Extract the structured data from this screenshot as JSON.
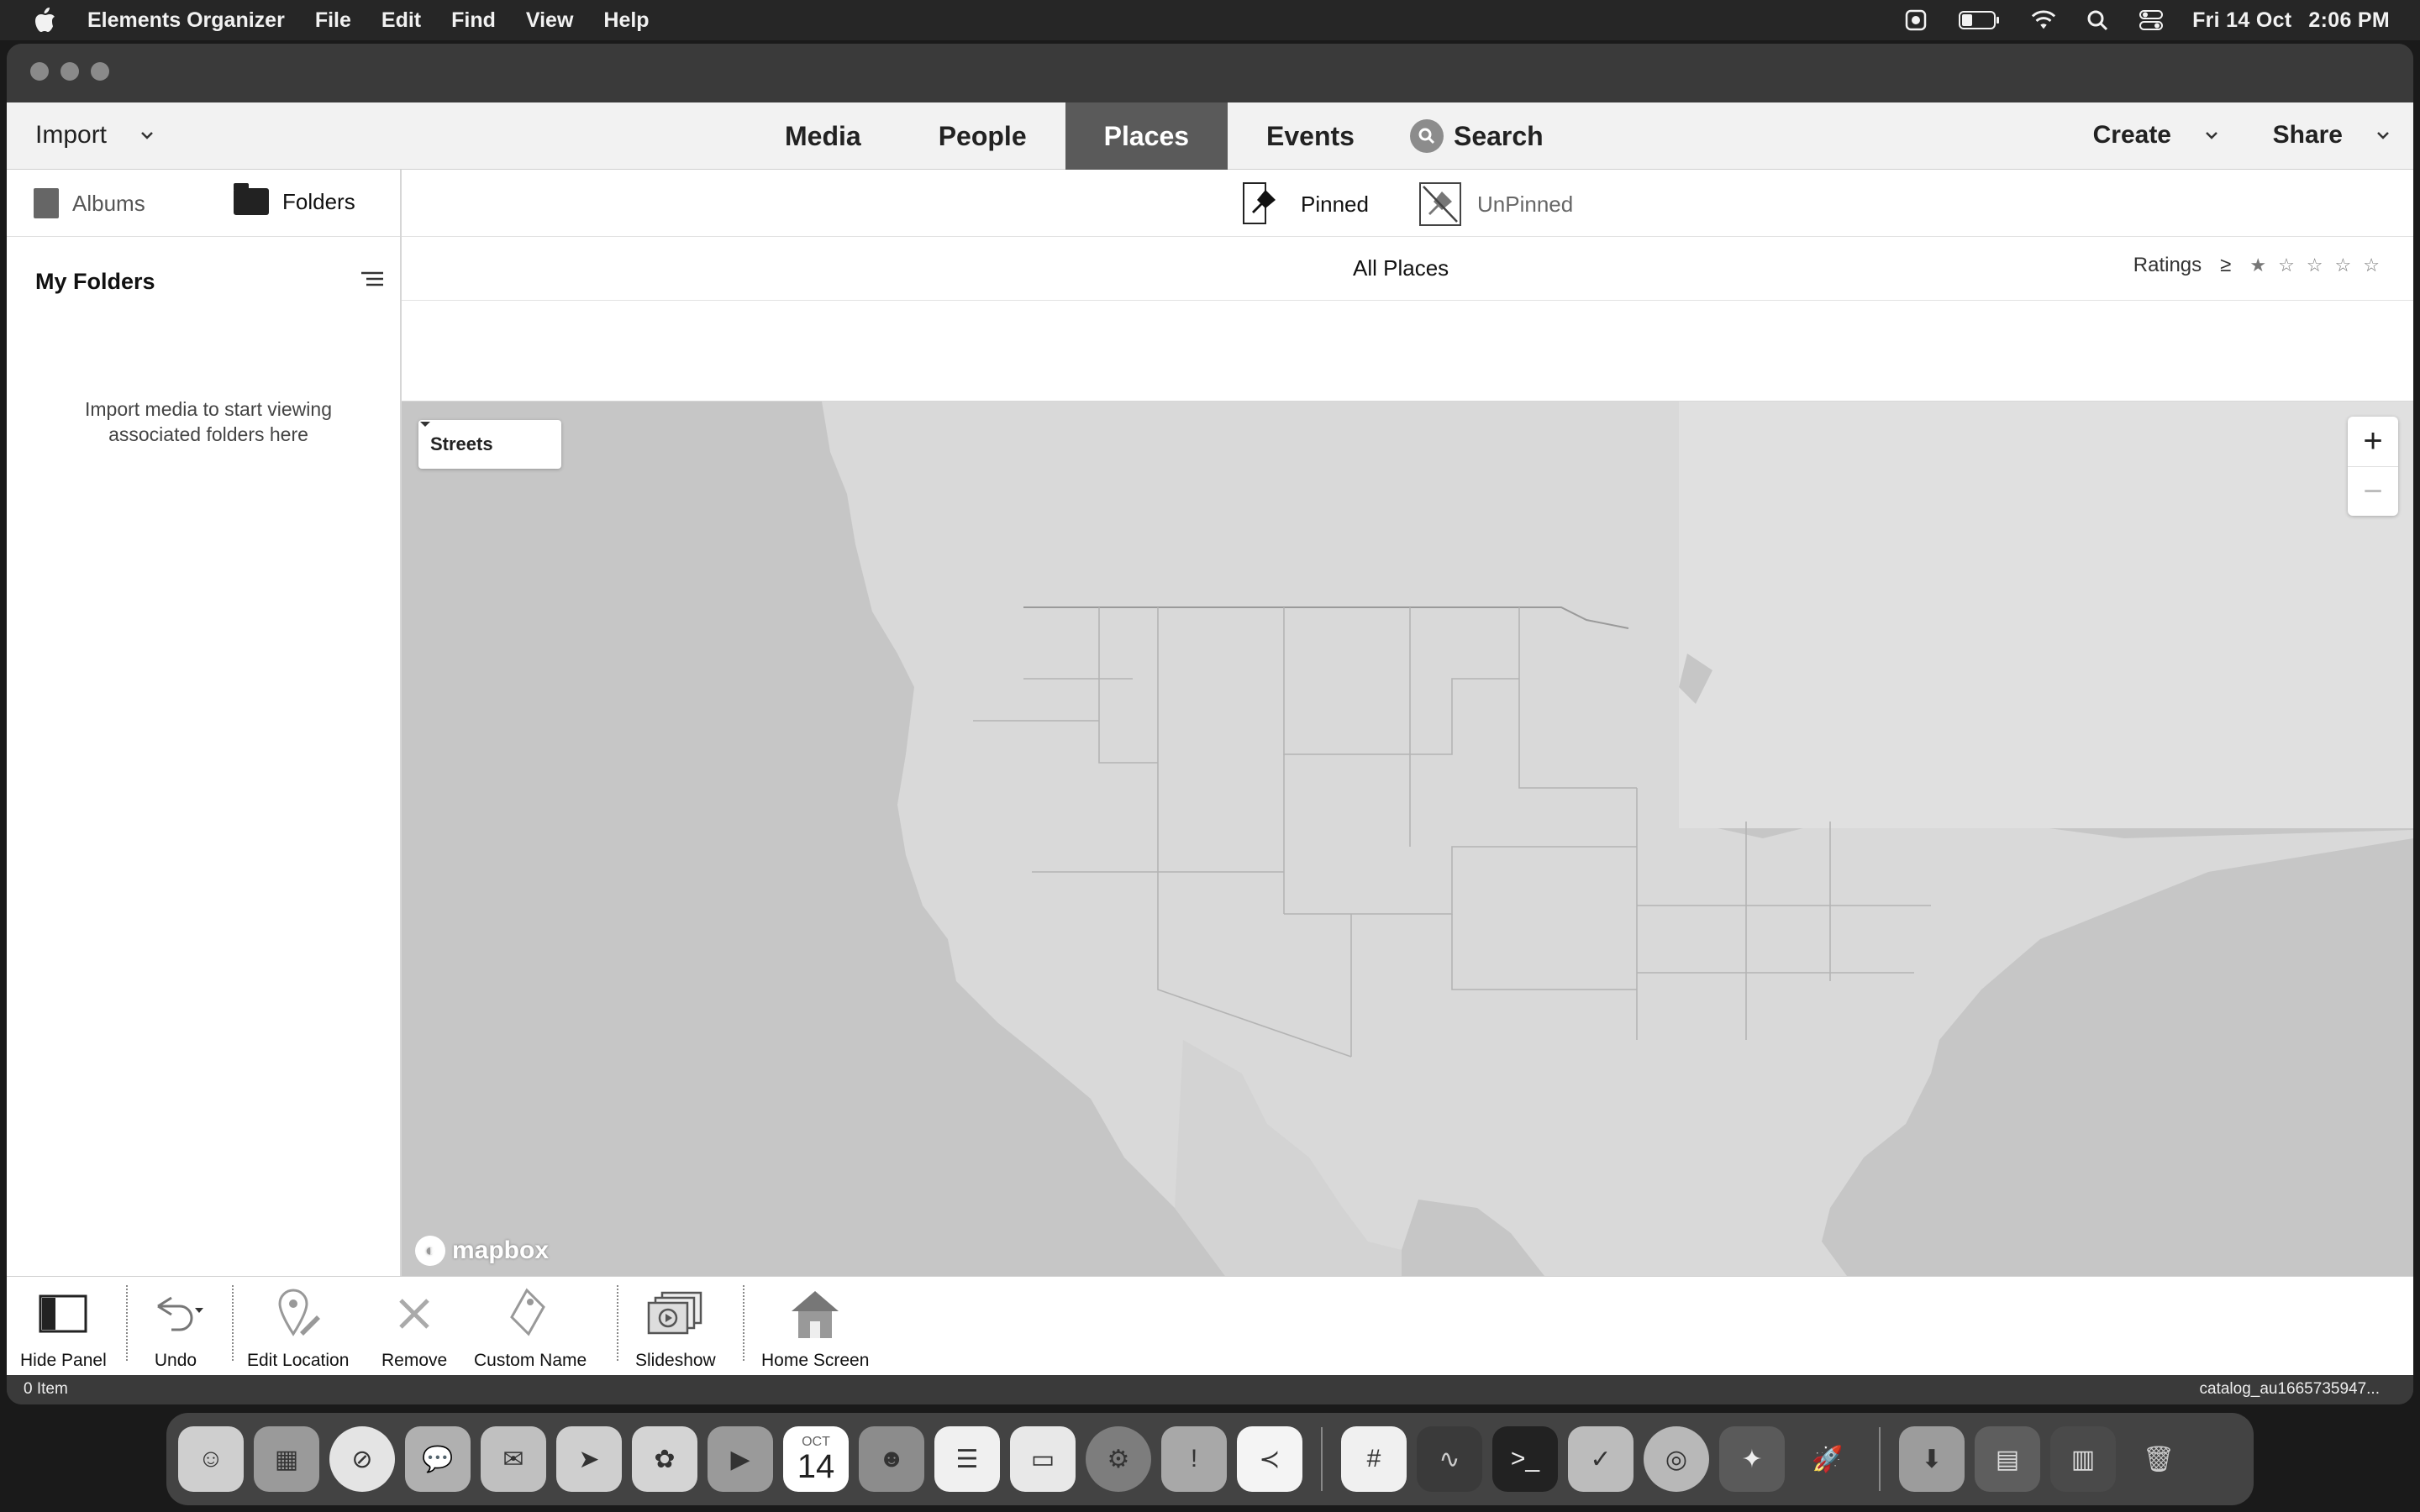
{
  "menubar": {
    "app_name": "Elements Organizer",
    "items": [
      "File",
      "Edit",
      "Find",
      "View",
      "Help"
    ],
    "date": "Fri 14 Oct",
    "time": "2:06 PM"
  },
  "topnav": {
    "import_label": "Import",
    "tabs": [
      "Media",
      "People",
      "Places",
      "Events"
    ],
    "active_tab": "Places",
    "search_label": "Search",
    "create_label": "Create",
    "share_label": "Share"
  },
  "left_panel": {
    "albums_tab": "Albums",
    "folders_tab": "Folders",
    "header": "My Folders",
    "empty_message": "Import media to start viewing associated folders here"
  },
  "content": {
    "pinned_label": "Pinned",
    "unpinned_label": "UnPinned",
    "all_places": "All Places",
    "ratings_label": "Ratings",
    "ratings_operator": "≥"
  },
  "map": {
    "style_value": "Streets",
    "zoom_in": "+",
    "zoom_out": "−",
    "attribution": "mapbox"
  },
  "bottom_toolbar": {
    "hide_panel": "Hide Panel",
    "undo": "Undo",
    "edit_location": "Edit Location",
    "remove": "Remove",
    "custom_name": "Custom Name",
    "slideshow": "Slideshow",
    "home_screen": "Home Screen"
  },
  "status": {
    "item_count": "0 Item",
    "catalog": "catalog_au1665735947..."
  },
  "dock": {
    "calendar_month": "OCT",
    "calendar_day": "14"
  },
  "colors": {
    "map_land": "#d9d9d9",
    "map_water": "#c6c6c6",
    "active_tab_bg": "#5a5a5a"
  }
}
